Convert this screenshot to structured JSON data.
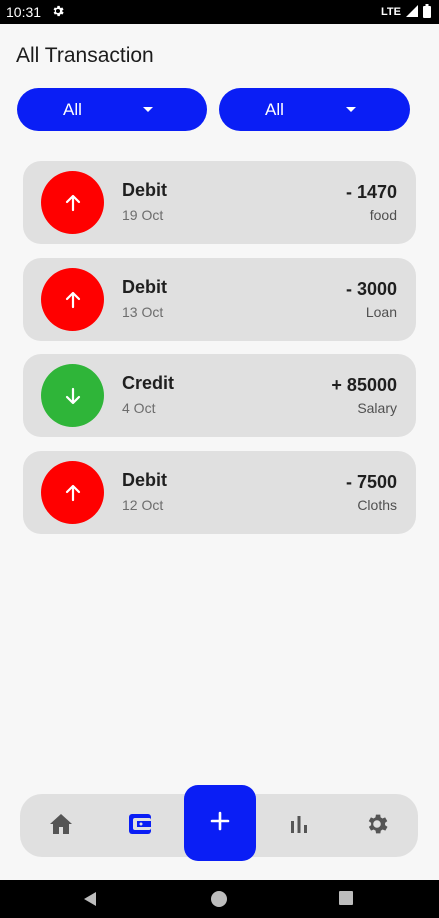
{
  "status_bar": {
    "time": "10:31",
    "network": "LTE"
  },
  "page_title": "All Transaction",
  "filters": [
    {
      "value": "All"
    },
    {
      "value": "All"
    }
  ],
  "colors": {
    "accent": "#0a1ef5",
    "debit": "#ff0000",
    "credit": "#2fb539",
    "card": "#e0e0e0"
  },
  "transactions": [
    {
      "type": "Debit",
      "date": "19 Oct",
      "amount": "- 1470",
      "category": "food",
      "icon": "arrow-up-icon"
    },
    {
      "type": "Debit",
      "date": "13 Oct",
      "amount": "- 3000",
      "category": "Loan",
      "icon": "arrow-up-icon"
    },
    {
      "type": "Credit",
      "date": "4 Oct",
      "amount": "+ 85000",
      "category": "Salary",
      "icon": "arrow-down-icon"
    },
    {
      "type": "Debit",
      "date": "12 Oct",
      "amount": "- 7500",
      "category": "Cloths",
      "icon": "arrow-up-icon"
    }
  ],
  "bottom_nav": {
    "items": [
      "home-icon",
      "wallet-icon",
      "add-icon",
      "bar-chart-icon",
      "settings-icon"
    ],
    "active": "wallet-icon"
  }
}
